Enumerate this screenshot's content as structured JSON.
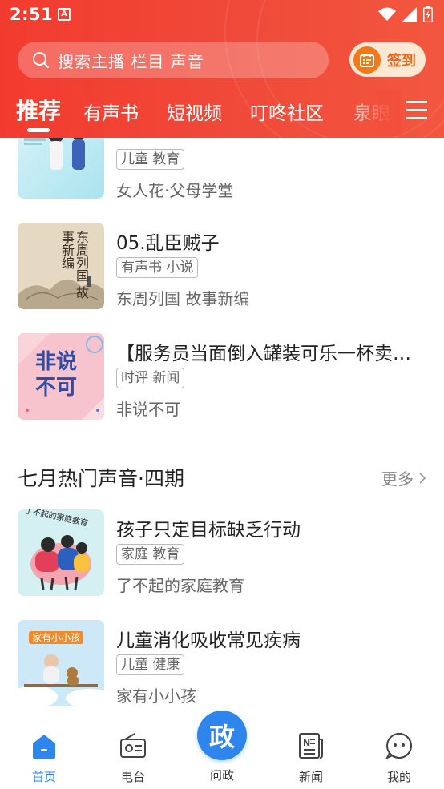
{
  "status_bar": {
    "time": "2:51",
    "app_badge": "A"
  },
  "search": {
    "placeholder": "搜索主播 栏目 声音"
  },
  "signin": {
    "label": "签到"
  },
  "tabs": [
    {
      "label": "推荐",
      "active": true
    },
    {
      "label": "有声书"
    },
    {
      "label": "短视频"
    },
    {
      "label": "叮咚社区"
    },
    {
      "label": "泉眼"
    }
  ],
  "list_top": [
    {
      "tag": "儿童 教育",
      "subtitle": "女人花·父母学堂",
      "thumb_text": ""
    },
    {
      "title": "05.乱臣贼子",
      "tag": "有声书 小说",
      "subtitle": "东周列国 故事新编",
      "thumb_text": "东周列国 故事新编"
    },
    {
      "title": "【服务员当面倒入罐装可乐一杯卖…",
      "tag": "时评 新闻",
      "subtitle": "非说不可",
      "thumb_text": "非说 不可"
    }
  ],
  "section": {
    "title": "七月热门声音·四期",
    "more": "更多"
  },
  "list_section": [
    {
      "title": "孩子只定目标缺乏行动",
      "tag": "家庭 教育",
      "subtitle": "了不起的家庭教育",
      "thumb_text": "了不起的家庭教育"
    },
    {
      "title": "儿童消化吸收常见疾病",
      "tag": "儿童 健康",
      "subtitle": "家有小小孩",
      "thumb_text": "家有小小孩"
    }
  ],
  "bottom_nav": [
    {
      "label": "首页",
      "icon": "home-icon",
      "active": true
    },
    {
      "label": "电台",
      "icon": "radio-icon"
    },
    {
      "label": "问政",
      "icon": "zheng-icon",
      "center_glyph": "政"
    },
    {
      "label": "新闻",
      "icon": "news-icon"
    },
    {
      "label": "我的",
      "icon": "profile-icon"
    }
  ],
  "colors": {
    "brand_red": "#f23b2f",
    "nav_active": "#2e7fe8",
    "signin_orange": "#f07a1a"
  }
}
